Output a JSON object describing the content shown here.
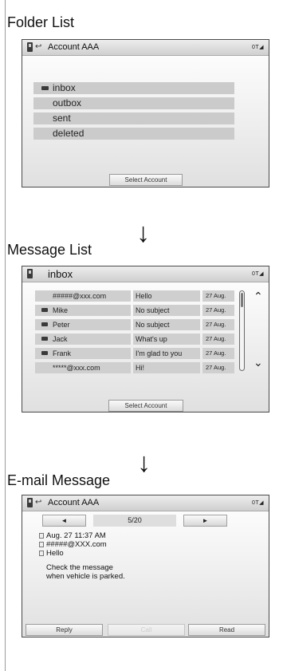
{
  "sections": {
    "folder_list_title": "Folder List",
    "message_list_title": "Message List",
    "email_message_title": "E-mail Message"
  },
  "arrow_glyph": "↓",
  "status_text": "0T◢",
  "folder_screen": {
    "header_title": "Account AAA",
    "folders": [
      {
        "label": "inbox",
        "has_icon": true
      },
      {
        "label": "outbox",
        "has_icon": false
      },
      {
        "label": "sent",
        "has_icon": false
      },
      {
        "label": "deleted",
        "has_icon": false
      }
    ],
    "select_account_label": "Select Account"
  },
  "message_screen": {
    "header_title": "inbox",
    "messages": [
      {
        "from": "#####@xxx.com",
        "subject": "Hello",
        "date": "27 Aug.",
        "has_icon": false
      },
      {
        "from": "Mike",
        "subject": "No subject",
        "date": "27 Aug.",
        "has_icon": true
      },
      {
        "from": "Peter",
        "subject": "No subject",
        "date": "27 Aug.",
        "has_icon": true
      },
      {
        "from": "Jack",
        "subject": "What's up",
        "date": "27 Aug.",
        "has_icon": true
      },
      {
        "from": "Frank",
        "subject": "I'm glad to you",
        "date": "27 Aug.",
        "has_icon": true
      },
      {
        "from": "*****@xxx.com",
        "subject": "Hi!",
        "date": "27 Aug.",
        "has_icon": false
      }
    ],
    "scroll_up_icon": "double-chevron-up",
    "scroll_down_icon": "double-chevron-down",
    "select_account_label": "Select Account"
  },
  "email_screen": {
    "header_title": "Account AAA",
    "pager": {
      "prev": "◄",
      "count": "5/20",
      "next": "►"
    },
    "date": "Aug. 27 11:37 AM",
    "from": "#####@XXX.com",
    "subject": "Hello",
    "body_line1": "Check the message",
    "body_line2": "when vehicle is parked.",
    "buttons": {
      "reply": "Reply",
      "call": "Call",
      "read": "Read"
    }
  }
}
